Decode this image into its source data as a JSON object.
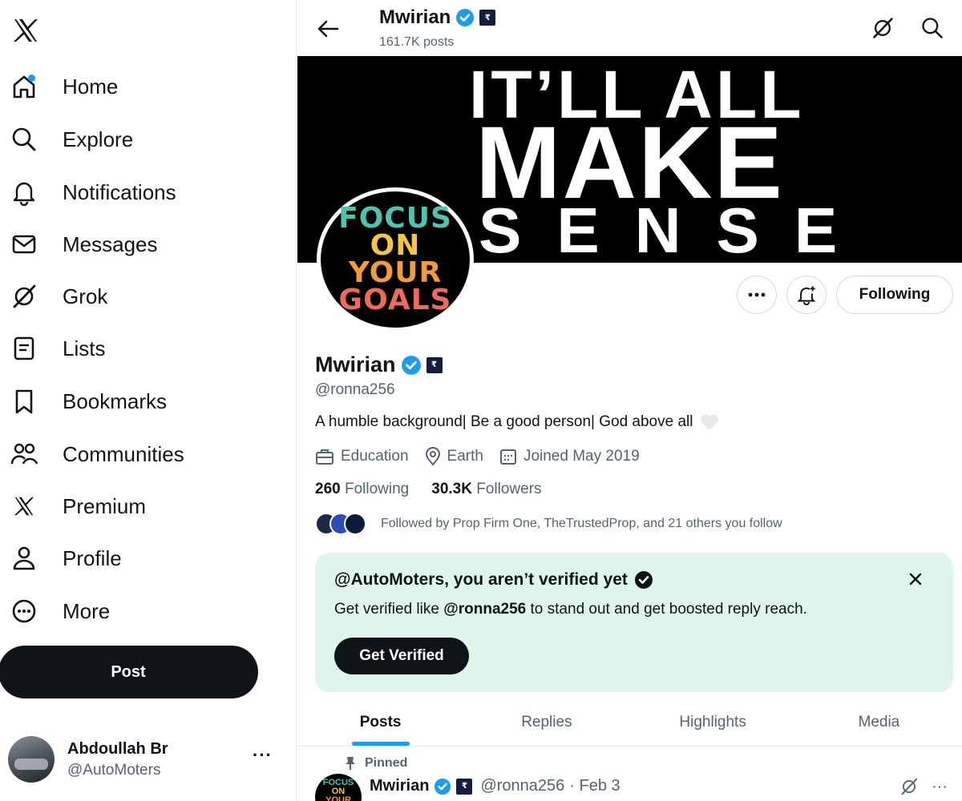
{
  "sidebar": {
    "items": [
      {
        "label": "Home",
        "icon": "home-icon"
      },
      {
        "label": "Explore",
        "icon": "search-icon"
      },
      {
        "label": "Notifications",
        "icon": "bell-icon"
      },
      {
        "label": "Messages",
        "icon": "envelope-icon"
      },
      {
        "label": "Grok",
        "icon": "grok-icon"
      },
      {
        "label": "Lists",
        "icon": "list-icon"
      },
      {
        "label": "Bookmarks",
        "icon": "bookmark-icon"
      },
      {
        "label": "Communities",
        "icon": "communities-icon"
      },
      {
        "label": "Premium",
        "icon": "x-logo-icon"
      },
      {
        "label": "Profile",
        "icon": "person-icon"
      },
      {
        "label": "More",
        "icon": "more-circle-icon"
      }
    ],
    "post_label": "Post",
    "account": {
      "name": "Abdoullah Br",
      "handle": "@AutoMoters"
    }
  },
  "header": {
    "name": "Mwirian",
    "posts": "161.7K posts"
  },
  "banner": {
    "line1": "IT’LL ALL",
    "line2": "MAKE",
    "line3": "SENSE"
  },
  "avatar_text": {
    "l1": "FOCUS",
    "l2": "ON",
    "l3": "YOUR",
    "l4": "GOALS"
  },
  "profile": {
    "follow_label": "Following",
    "name": "Mwirian",
    "handle": "@ronna256",
    "bio": "A humble background| Be a good person| God above all",
    "category": "Education",
    "location": "Earth",
    "joined": "Joined May 2019",
    "following_count": "260",
    "following_label": "Following",
    "followers_count": "30.3K",
    "followers_label": "Followers",
    "followed_by": "Followed by Prop Firm One, TheTrustedProp, and 21 others you follow"
  },
  "verify": {
    "title": "@AutoMoters, you aren’t verified yet",
    "text_pre": "Get verified like ",
    "text_handle": "@ronna256",
    "text_post": " to stand out and get boosted reply reach.",
    "button": "Get Verified"
  },
  "tabs": [
    "Posts",
    "Replies",
    "Highlights",
    "Media"
  ],
  "pinned_post": {
    "pinned_label": "Pinned",
    "name": "Mwirian",
    "handle": "@ronna256",
    "date": "· Feb 3",
    "more": "···"
  },
  "colors": {
    "accent": "#1d9bf0",
    "verify_bg": "#dff5ec",
    "text": "#0f1419",
    "muted": "#536471"
  }
}
